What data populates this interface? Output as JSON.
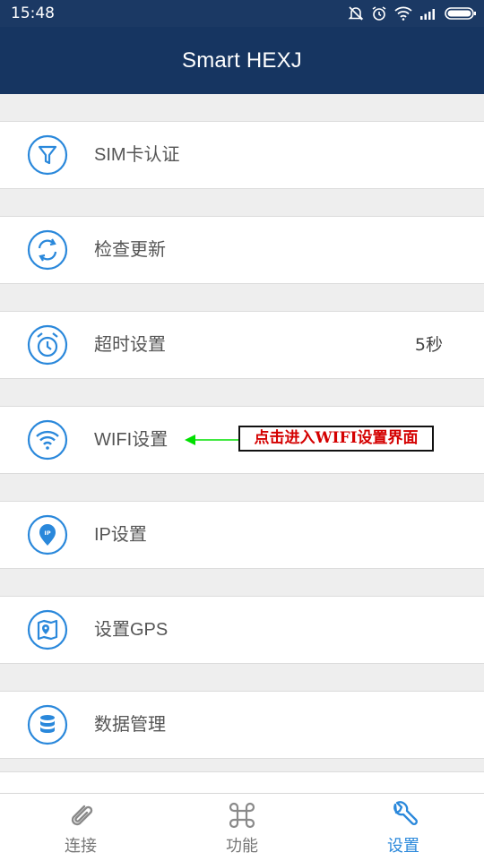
{
  "status_bar": {
    "time": "15:48"
  },
  "app_bar": {
    "title": "Smart HEXJ"
  },
  "settings": {
    "items": [
      {
        "label": "SIM卡认证",
        "icon": "filter-icon"
      },
      {
        "label": "检查更新",
        "icon": "refresh-icon"
      },
      {
        "label": "超时设置",
        "value": "5秒",
        "icon": "alarm-clock-icon"
      },
      {
        "label": "WIFI设置",
        "icon": "wifi-icon"
      },
      {
        "label": "IP设置",
        "icon": "ip-location-icon"
      },
      {
        "label": "设置GPS",
        "icon": "map-pin-icon"
      },
      {
        "label": "数据管理",
        "icon": "database-icon"
      }
    ]
  },
  "annotation": {
    "text": "点击进入WIFI设置界面",
    "arrow_color": "#00e000",
    "text_color": "#d40000"
  },
  "tab_bar": {
    "tabs": [
      {
        "label": "连接",
        "icon": "paperclip-icon",
        "active": false
      },
      {
        "label": "功能",
        "icon": "command-icon",
        "active": false
      },
      {
        "label": "设置",
        "icon": "wrench-icon",
        "active": true
      }
    ]
  },
  "colors": {
    "header": "#163561",
    "accent": "#2a88db",
    "background": "#eeeeee"
  }
}
